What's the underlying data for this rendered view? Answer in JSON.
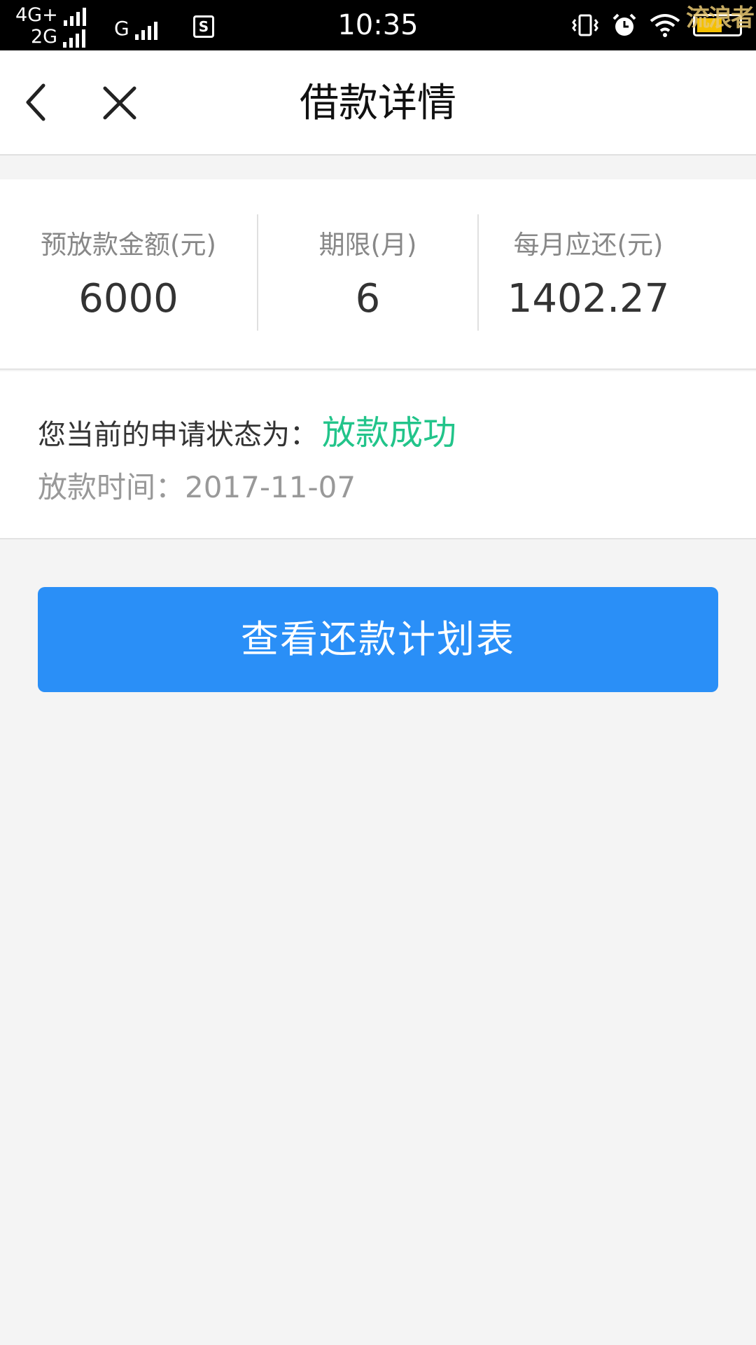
{
  "status_bar": {
    "network_top": "4G+",
    "network_bottom": "2G",
    "network_g": "G",
    "sim_icon": "S",
    "time": "10:35",
    "icons": [
      "vibrate-icon",
      "alarm-icon",
      "wifi-icon",
      "battery-icon"
    ],
    "battery_level": 0.55,
    "watermark": "流浪者"
  },
  "header": {
    "title": "借款详情",
    "back_icon": "chevron-left-icon",
    "close_icon": "close-icon"
  },
  "summary": [
    {
      "label": "预放款金额(元)",
      "value": "6000"
    },
    {
      "label": "期限(月)",
      "value": "6"
    },
    {
      "label": "每月应还(元)",
      "value": "1402.27"
    }
  ],
  "status": {
    "prefix": "您当前的申请状态为：",
    "value": "放款成功",
    "value_color": "#22c48a",
    "time_label": "放款时间：",
    "time_value": "2017-11-07"
  },
  "action": {
    "plan_button_label": "查看还款计划表",
    "button_color": "#2a8ff7"
  }
}
